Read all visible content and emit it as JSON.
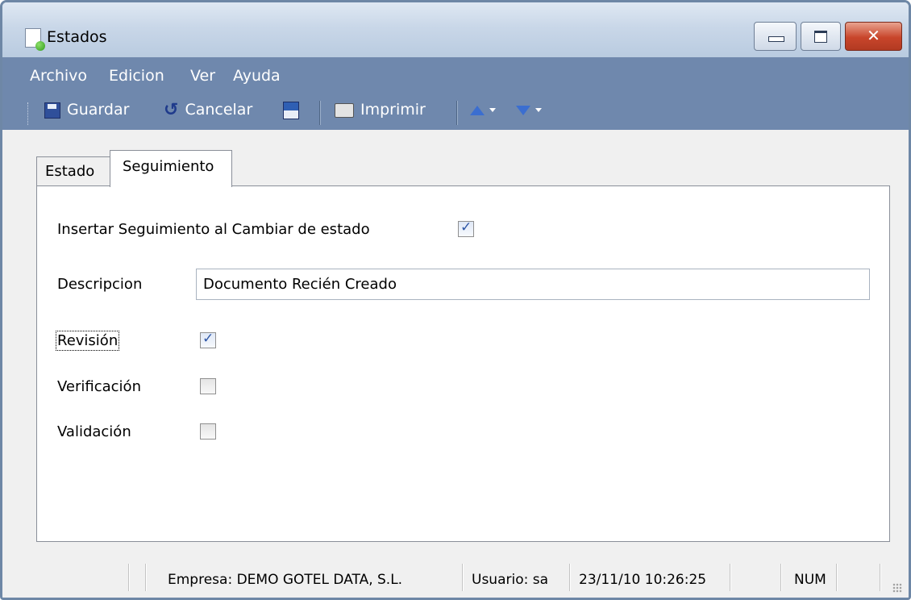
{
  "window": {
    "title": "Estados"
  },
  "menu": {
    "items": [
      "Archivo",
      "Edicion",
      "Ver",
      "Ayuda"
    ]
  },
  "toolbar": {
    "save_label": "Guardar",
    "cancel_label": "Cancelar",
    "print_label": "Imprimir",
    "icons": [
      "save-icon",
      "cancel-refresh-icon",
      "export-icon",
      "printer-icon",
      "arrow-up-icon",
      "arrow-down-icon"
    ]
  },
  "tabs": [
    {
      "label": "Estado",
      "active": false
    },
    {
      "label": "Seguimiento",
      "active": true
    }
  ],
  "form": {
    "insert_label": "Insertar Seguimiento al Cambiar de estado",
    "insert_checked": true,
    "description_label": "Descripcion",
    "description_value": "Documento Recién Creado",
    "revision_label": "Revisión",
    "revision_checked": true,
    "verification_label": "Verificación",
    "verification_checked": false,
    "validation_label": "Validación",
    "validation_checked": false
  },
  "status": {
    "company": "Empresa: DEMO GOTEL DATA, S.L.",
    "user": "Usuario: sa",
    "datetime": "23/11/10 10:26:25",
    "num": "NUM"
  },
  "colors": {
    "menu_bg": "#6f88ad",
    "close_button": "#c8452b",
    "accent": "#2e56a6"
  }
}
